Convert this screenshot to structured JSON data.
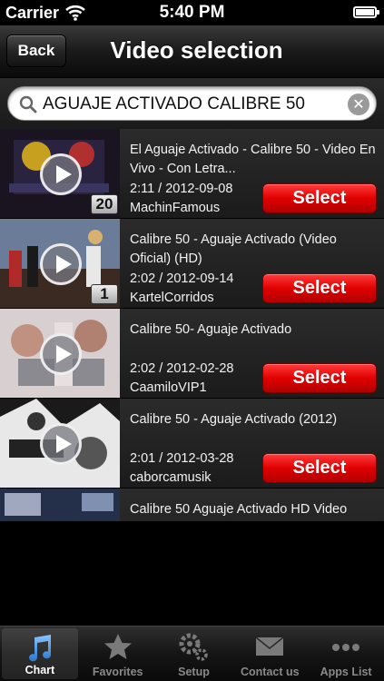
{
  "status_bar": {
    "carrier": "Carrier",
    "time": "5:40 PM"
  },
  "nav": {
    "back_label": "Back",
    "title": "Video selection"
  },
  "search": {
    "value": "AGUAJE ACTIVADO CALIBRE 50",
    "clear_label": "✕"
  },
  "videos": [
    {
      "title": "El Aguaje Activado - Calibre 50 - Video En Vivo - Con Letra...",
      "duration_date": "2:11 / 2012-09-08",
      "uploader": "MachinFamous",
      "rank": "20",
      "select_label": "Select"
    },
    {
      "title": "Calibre 50 - Aguaje Activado (Video Oficial) (HD)",
      "duration_date": "2:02 / 2012-09-14",
      "uploader": "KartelCorridos",
      "rank": "1",
      "select_label": "Select"
    },
    {
      "title": "Calibre 50- Aguaje Activado",
      "duration_date": "2:02 / 2012-02-28",
      "uploader": "CaamiloVIP1",
      "rank": "",
      "select_label": "Select"
    },
    {
      "title": "Calibre 50 - Aguaje Activado (2012)",
      "duration_date": "2:01 / 2012-03-28",
      "uploader": "caborcamusik",
      "rank": "",
      "select_label": "Select"
    },
    {
      "title": "Calibre 50 Aguaje Activado HD Video",
      "duration_date": "",
      "uploader": "",
      "rank": "",
      "select_label": ""
    }
  ],
  "tabs": [
    {
      "label": "Chart",
      "icon": "music-note-icon"
    },
    {
      "label": "Favorites",
      "icon": "star-icon"
    },
    {
      "label": "Setup",
      "icon": "gears-icon"
    },
    {
      "label": "Contact us",
      "icon": "envelope-icon"
    },
    {
      "label": "Apps List",
      "icon": "more-dots-icon"
    }
  ],
  "colors": {
    "select_red": "#e00000",
    "active_tab_blue": "#4a9be0"
  }
}
